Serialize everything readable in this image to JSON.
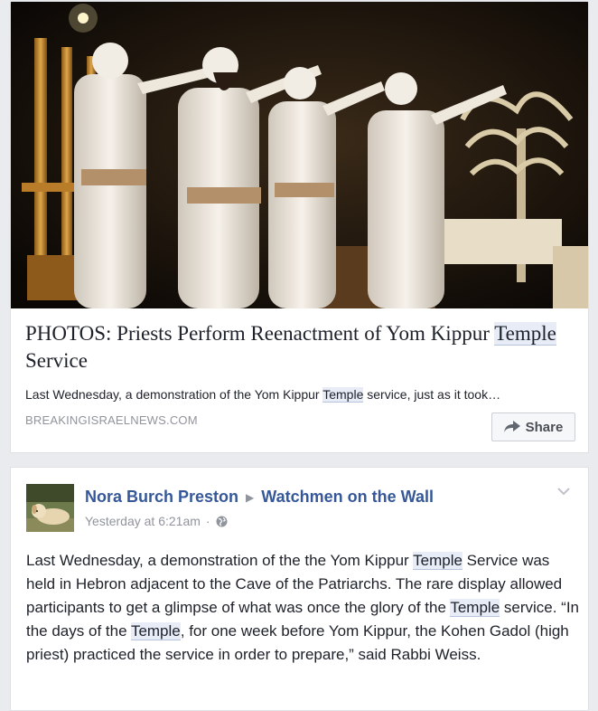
{
  "link_preview": {
    "image_alt": "Priests in white garments performing the Yom Kippur Temple service reenactment",
    "title_before": "PHOTOS: Priests Perform Reenactment of Yom Kippur ",
    "title_highlight": "Temple",
    "title_after": " Service",
    "description_before": "Last Wednesday, a demonstration of the Yom Kippur ",
    "description_highlight": "Temple",
    "description_after": " service, just as it took…",
    "domain": "BREAKINGISRAELNEWS.COM",
    "share_label": "Share"
  },
  "post": {
    "author": "Nora Burch Preston",
    "group": "Watchmen on the Wall",
    "timestamp": "Yesterday at 6:21am",
    "privacy_icon": "globe-icon",
    "body": {
      "p1": "Last Wednesday, a demonstration of the the Yom Kippur ",
      "h1": "Temple",
      "p2": " Service was held in Hebron adjacent to the Cave of the Patriarchs. The rare display allowed participants to get a glimpse of what was once the glory of the ",
      "h2": "Temple",
      "p3": " service. “In the days of the ",
      "h3": "Temple",
      "p4": ", for one week before Yom Kippur, the Kohen Gadol (high priest) practiced the service in order to prepare,” said Rabbi Weiss."
    }
  },
  "colors": {
    "link": "#365899",
    "text": "#1d2129",
    "muted": "#90949c",
    "highlight": "#e7ecf6"
  }
}
